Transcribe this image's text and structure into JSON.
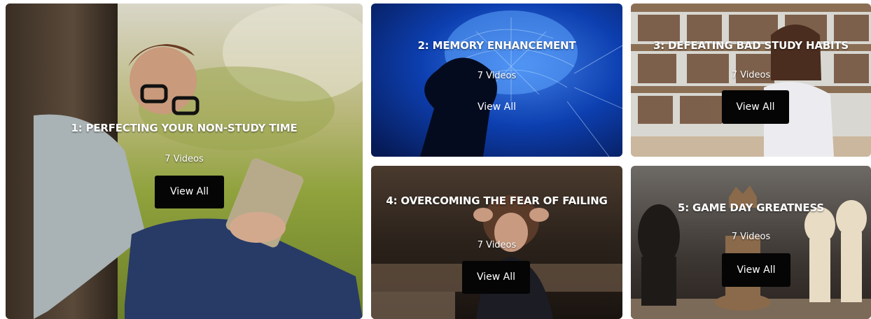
{
  "cards": [
    {
      "title": "1: PERFECTING YOUR NON-STUDY TIME",
      "count": "7 Videos",
      "button": "View All"
    },
    {
      "title": "2: MEMORY ENHANCEMENT",
      "count": "7 Videos",
      "button": "View All"
    },
    {
      "title": "3: DEFEATING BAD STUDY HABITS",
      "count": "7 Videos",
      "button": "View All"
    },
    {
      "title": "4: OVERCOMING THE FEAR OF FAILING",
      "count": "7 Videos",
      "button": "View All"
    },
    {
      "title": "5: GAME DAY GREATNESS",
      "count": "7 Videos",
      "button": "View All"
    }
  ],
  "colors": {
    "button_bg": "#050505",
    "text": "#ffffff",
    "card2_blue": "#0d3fb0",
    "card1_green": "#8aa03a"
  }
}
